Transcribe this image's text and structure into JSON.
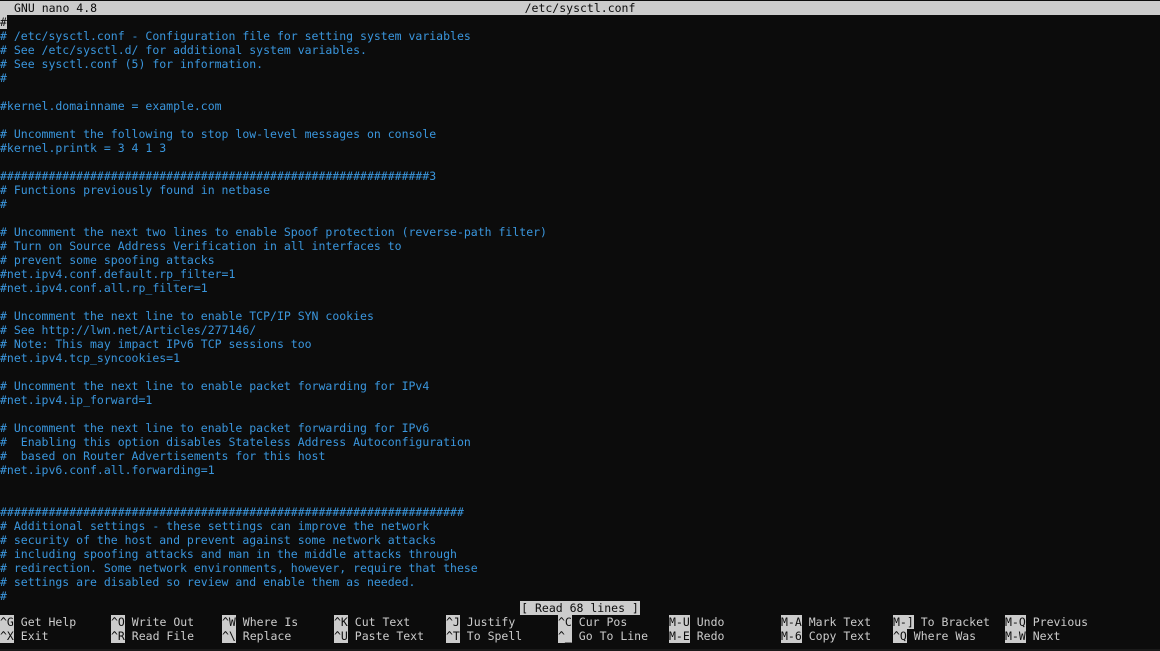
{
  "title_bar": {
    "app_name": "GNU nano 4.8",
    "file_name": "/etc/sysctl.conf"
  },
  "editor": {
    "lines": [
      "#",
      "# /etc/sysctl.conf - Configuration file for setting system variables",
      "# See /etc/sysctl.d/ for additional system variables.",
      "# See sysctl.conf (5) for information.",
      "#",
      "",
      "#kernel.domainname = example.com",
      "",
      "# Uncomment the following to stop low-level messages on console",
      "#kernel.printk = 3 4 1 3",
      "",
      "##############################################################3",
      "# Functions previously found in netbase",
      "#",
      "",
      "# Uncomment the next two lines to enable Spoof protection (reverse-path filter)",
      "# Turn on Source Address Verification in all interfaces to",
      "# prevent some spoofing attacks",
      "#net.ipv4.conf.default.rp_filter=1",
      "#net.ipv4.conf.all.rp_filter=1",
      "",
      "# Uncomment the next line to enable TCP/IP SYN cookies",
      "# See http://lwn.net/Articles/277146/",
      "# Note: This may impact IPv6 TCP sessions too",
      "#net.ipv4.tcp_syncookies=1",
      "",
      "# Uncomment the next line to enable packet forwarding for IPv4",
      "#net.ipv4.ip_forward=1",
      "",
      "# Uncomment the next line to enable packet forwarding for IPv6",
      "#  Enabling this option disables Stateless Address Autoconfiguration",
      "#  based on Router Advertisements for this host",
      "#net.ipv6.conf.all.forwarding=1",
      "",
      "",
      "###################################################################",
      "# Additional settings - these settings can improve the network",
      "# security of the host and prevent against some network attacks",
      "# including spoofing attacks and man in the middle attacks through",
      "# redirection. Some network environments, however, require that these",
      "# settings are disabled so review and enable them as needed.",
      "#"
    ]
  },
  "status_message": "[ Read 68 lines ]",
  "shortcuts": {
    "top": [
      {
        "key": "^G",
        "label": "Get Help"
      },
      {
        "key": "^O",
        "label": "Write Out"
      },
      {
        "key": "^W",
        "label": "Where Is"
      },
      {
        "key": "^K",
        "label": "Cut Text"
      },
      {
        "key": "^J",
        "label": "Justify"
      },
      {
        "key": "^C",
        "label": "Cur Pos"
      },
      {
        "key": "M-U",
        "label": "Undo"
      },
      {
        "key": "M-A",
        "label": "Mark Text"
      },
      {
        "key": "M-]",
        "label": "To Bracket"
      },
      {
        "key": "M-Q",
        "label": "Previous"
      }
    ],
    "bottom": [
      {
        "key": "^X",
        "label": "Exit"
      },
      {
        "key": "^R",
        "label": "Read File"
      },
      {
        "key": "^\\",
        "label": "Replace"
      },
      {
        "key": "^U",
        "label": "Paste Text"
      },
      {
        "key": "^T",
        "label": "To Spell"
      },
      {
        "key": "^_",
        "label": "Go To Line"
      },
      {
        "key": "M-E",
        "label": "Redo"
      },
      {
        "key": "M-6",
        "label": "Copy Text"
      },
      {
        "key": "^Q",
        "label": "Where Was"
      },
      {
        "key": "M-W",
        "label": "Next"
      }
    ]
  }
}
